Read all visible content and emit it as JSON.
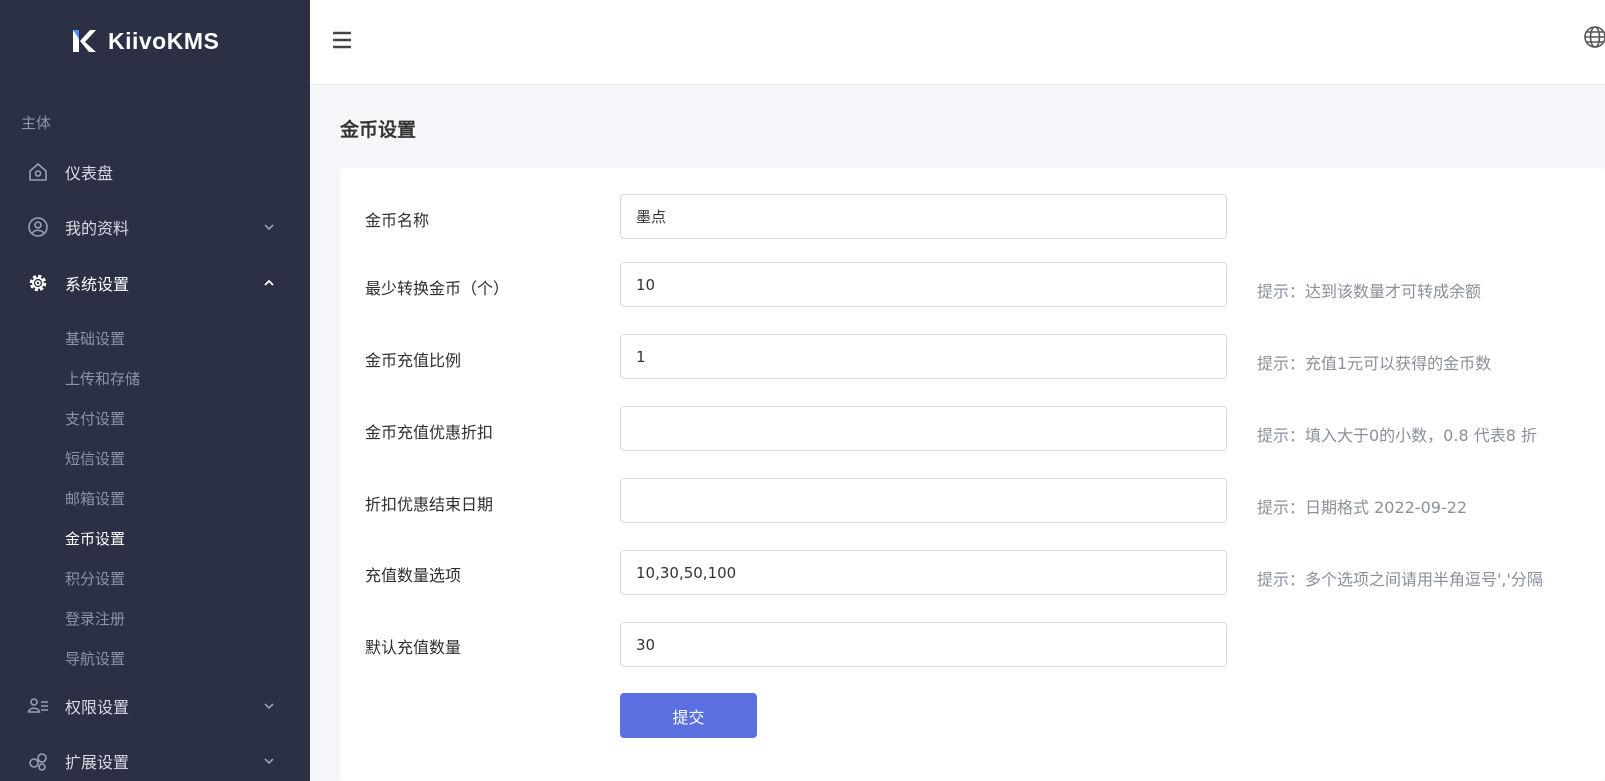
{
  "app": {
    "name": "KiivoKMS"
  },
  "sidebar": {
    "section_label": "主体",
    "items": [
      {
        "label": "仪表盘",
        "icon": "home-icon"
      },
      {
        "label": "我的资料",
        "icon": "user-circle-icon"
      },
      {
        "label": "系统设置",
        "icon": "gear-icon"
      },
      {
        "label": "权限设置",
        "icon": "users-icon"
      },
      {
        "label": "扩展设置",
        "icon": "extension-icon"
      }
    ],
    "sub_items": [
      {
        "label": "基础设置"
      },
      {
        "label": "上传和存储"
      },
      {
        "label": "支付设置"
      },
      {
        "label": "短信设置"
      },
      {
        "label": "邮箱设置"
      },
      {
        "label": "金币设置"
      },
      {
        "label": "积分设置"
      },
      {
        "label": "登录注册"
      },
      {
        "label": "导航设置"
      }
    ]
  },
  "page": {
    "title": "金币设置"
  },
  "form": {
    "fields": [
      {
        "label": "金币名称",
        "value": "墨点",
        "hint": ""
      },
      {
        "label": "最少转换金币（个）",
        "value": "10",
        "hint": "提示：达到该数量才可转成余额"
      },
      {
        "label": "金币充值比例",
        "value": "1",
        "hint": "提示：充值1元可以获得的金币数"
      },
      {
        "label": "金币充值优惠折扣",
        "value": "",
        "hint": "提示：填入大于0的小数，0.8 代表8 折"
      },
      {
        "label": "折扣优惠结束日期",
        "value": "",
        "hint": "提示：日期格式 2022-09-22"
      },
      {
        "label": "充值数量选项",
        "value": "10,30,50,100",
        "hint": "提示：多个选项之间请用半角逗号','分隔"
      },
      {
        "label": "默认充值数量",
        "value": "30",
        "hint": ""
      }
    ],
    "submit_label": "提交"
  },
  "colors": {
    "sidebar_bg": "#2b3044",
    "accent": "#5a6fe0"
  }
}
